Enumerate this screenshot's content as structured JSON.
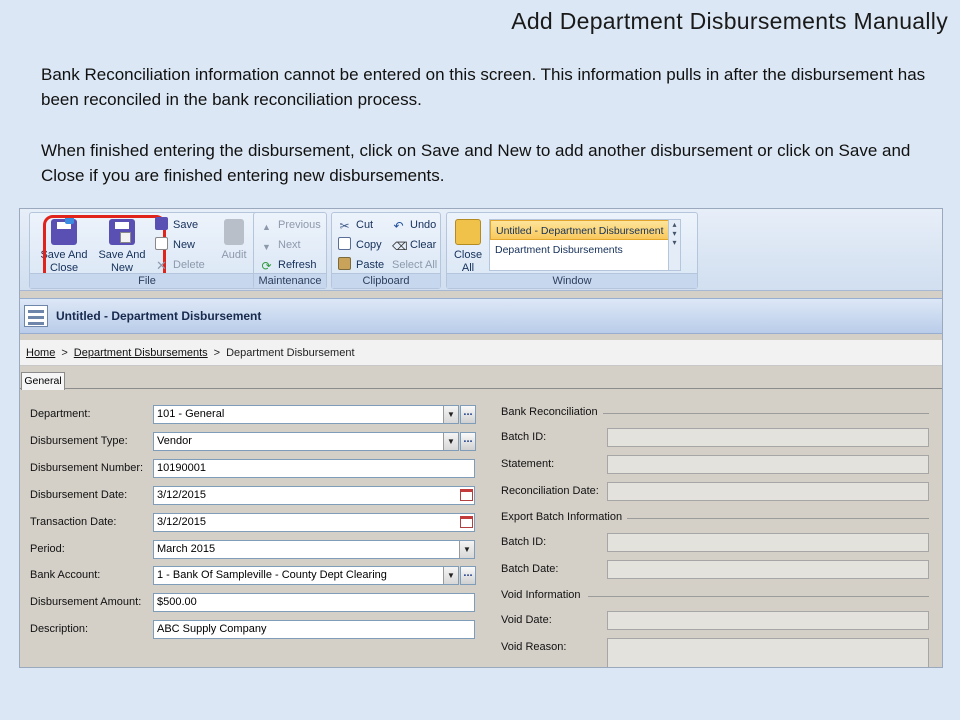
{
  "slide": {
    "title": "Add Department Disbursements Manually",
    "paragraph1": "Bank Reconciliation information cannot be entered on this screen.  This information pulls in after the disbursement has been reconciled in the bank reconciliation process.",
    "paragraph2": "When finished entering the disbursement, click on Save and New to add another disbursement or click on Save and Close if you are finished entering new disbursements."
  },
  "ribbon": {
    "file": {
      "label": "File",
      "save_and_close": "Save And Close",
      "save_and_new": "Save And New",
      "save": "Save",
      "new": "New",
      "delete": "Delete",
      "audit": "Audit"
    },
    "maintenance": {
      "label": "Maintenance",
      "previous": "Previous",
      "next": "Next",
      "refresh": "Refresh"
    },
    "clipboard": {
      "label": "Clipboard",
      "cut": "Cut",
      "copy": "Copy",
      "paste": "Paste",
      "undo": "Undo",
      "clear": "Clear",
      "select_all": "Select All"
    },
    "window": {
      "label": "Window",
      "close_all": "Close All",
      "items": [
        "Untitled - Department Disbursement",
        "Department Disbursements"
      ]
    }
  },
  "document": {
    "title": "Untitled - Department Disbursement",
    "breadcrumb": [
      "Home",
      "Department Disbursements",
      "Department Disbursement"
    ],
    "tab": "General"
  },
  "form": {
    "department": {
      "label": "Department:",
      "value": "101 - General"
    },
    "disbursement_type": {
      "label": "Disbursement Type:",
      "value": "Vendor"
    },
    "disbursement_number": {
      "label": "Disbursement Number:",
      "value": "10190001"
    },
    "disbursement_date": {
      "label": "Disbursement Date:",
      "value": "3/12/2015"
    },
    "transaction_date": {
      "label": "Transaction Date:",
      "value": "3/12/2015"
    },
    "period": {
      "label": "Period:",
      "value": "March 2015"
    },
    "bank_account": {
      "label": "Bank Account:",
      "value": "1 - Bank Of Sampleville - County Dept Clearing"
    },
    "disbursement_amount": {
      "label": "Disbursement Amount:",
      "value": "$500.00"
    },
    "description": {
      "label": "Description:",
      "value": "ABC Supply Company"
    },
    "bank_reconciliation": {
      "heading": "Bank Reconciliation",
      "batch_id": "Batch ID:",
      "statement": "Statement:",
      "reconciliation_date": "Reconciliation Date:"
    },
    "export_batch": {
      "heading": "Export Batch Information",
      "batch_id": "Batch ID:",
      "batch_date": "Batch Date:"
    },
    "void_information": {
      "heading": "Void Information",
      "void_date": "Void Date:",
      "void_reason": "Void Reason:"
    },
    "ellipsis": "..."
  },
  "colors": {
    "highlight_ring": "#e0241b",
    "active_window_item": "#f9c85c",
    "slide_background": "#dbe7f4"
  }
}
